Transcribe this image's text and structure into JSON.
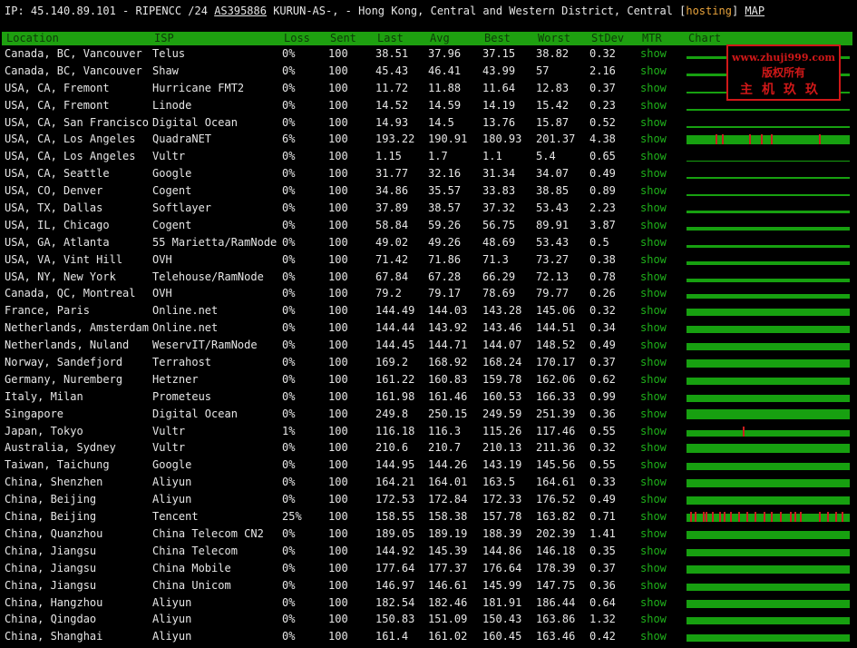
{
  "top": {
    "prefix": "IP: 45.140.89.101 - RIPENCC /24 ",
    "asn": "AS395886",
    "middle": " KURUN-AS-, - Hong Kong, Central and Western District, Central [",
    "tag": "hosting",
    "suffix": "] ",
    "map": "MAP"
  },
  "headers": {
    "location": "Location",
    "isp": "ISP",
    "loss": "Loss",
    "sent": "Sent",
    "last": "Last",
    "avg": "Avg",
    "best": "Best",
    "worst": "Worst",
    "stdev": "StDev",
    "mtr": "MTR",
    "chart": "Chart"
  },
  "watermark": {
    "line1": "www.zhuji999.com",
    "line2": "版权所有",
    "line3": "主机玖玖"
  },
  "colors": {
    "header_bg": "#1ea010",
    "link": "#1fb11a",
    "loss_spike": "#cc1f1f",
    "accent": "#e8a33c"
  },
  "rows": [
    {
      "location": "Canada, BC, Vancouver",
      "isp": "Telus",
      "loss": "0%",
      "sent": "100",
      "last": "38.51",
      "avg": "37.96",
      "best": "37.15",
      "worst": "38.82",
      "stdev": "0.32",
      "mtr": "show",
      "chart_level": 0.3,
      "spikes": []
    },
    {
      "location": "Canada, BC, Vancouver",
      "isp": "Shaw",
      "loss": "0%",
      "sent": "100",
      "last": "45.43",
      "avg": "46.41",
      "best": "43.99",
      "worst": "57",
      "stdev": "2.16",
      "mtr": "show",
      "chart_level": 0.3,
      "spikes": []
    },
    {
      "location": "USA, CA, Fremont",
      "isp": "Hurricane FMT2",
      "loss": "0%",
      "sent": "100",
      "last": "11.72",
      "avg": "11.88",
      "best": "11.64",
      "worst": "12.83",
      "stdev": "0.37",
      "mtr": "show",
      "chart_level": 0.2,
      "spikes": []
    },
    {
      "location": "USA, CA, Fremont",
      "isp": "Linode",
      "loss": "0%",
      "sent": "100",
      "last": "14.52",
      "avg": "14.59",
      "best": "14.19",
      "worst": "15.42",
      "stdev": "0.23",
      "mtr": "show",
      "chart_level": 0.2,
      "spikes": []
    },
    {
      "location": "USA, CA, San Francisco",
      "isp": "Digital Ocean",
      "loss": "0%",
      "sent": "100",
      "last": "14.93",
      "avg": "14.5",
      "best": "13.76",
      "worst": "15.87",
      "stdev": "0.52",
      "mtr": "show",
      "chart_level": 0.2,
      "spikes": []
    },
    {
      "location": "USA, CA, Los Angeles",
      "isp": "QuadraNET",
      "loss": "6%",
      "sent": "100",
      "last": "193.22",
      "avg": "190.91",
      "best": "180.93",
      "worst": "201.37",
      "stdev": "4.38",
      "mtr": "show",
      "chart_level": 0.9,
      "spikes": [
        0.18,
        0.22,
        0.39,
        0.46,
        0.52,
        0.82
      ]
    },
    {
      "location": "USA, CA, Los Angeles",
      "isp": "Vultr",
      "loss": "0%",
      "sent": "100",
      "last": "1.15",
      "avg": "1.7",
      "best": "1.1",
      "worst": "5.4",
      "stdev": "0.65",
      "mtr": "show",
      "chart_level": 0.1,
      "spikes": []
    },
    {
      "location": "USA, CA, Seattle",
      "isp": "Google",
      "loss": "0%",
      "sent": "100",
      "last": "31.77",
      "avg": "32.16",
      "best": "31.34",
      "worst": "34.07",
      "stdev": "0.49",
      "mtr": "show",
      "chart_level": 0.2,
      "spikes": []
    },
    {
      "location": "USA, CO, Denver",
      "isp": "Cogent",
      "loss": "0%",
      "sent": "100",
      "last": "34.86",
      "avg": "35.57",
      "best": "33.83",
      "worst": "38.85",
      "stdev": "0.89",
      "mtr": "show",
      "chart_level": 0.2,
      "spikes": []
    },
    {
      "location": "USA, TX, Dallas",
      "isp": "Softlayer",
      "loss": "0%",
      "sent": "100",
      "last": "37.89",
      "avg": "38.57",
      "best": "37.32",
      "worst": "53.43",
      "stdev": "2.23",
      "mtr": "show",
      "chart_level": 0.25,
      "spikes": []
    },
    {
      "location": "USA, IL, Chicago",
      "isp": "Cogent",
      "loss": "0%",
      "sent": "100",
      "last": "58.84",
      "avg": "59.26",
      "best": "56.75",
      "worst": "89.91",
      "stdev": "3.87",
      "mtr": "show",
      "chart_level": 0.35,
      "spikes": []
    },
    {
      "location": "USA, GA, Atlanta",
      "isp": "55 Marietta/RamNode",
      "loss": "0%",
      "sent": "100",
      "last": "49.02",
      "avg": "49.26",
      "best": "48.69",
      "worst": "53.43",
      "stdev": "0.5",
      "mtr": "show",
      "chart_level": 0.3,
      "spikes": []
    },
    {
      "location": "USA, VA, Vint Hill",
      "isp": "OVH",
      "loss": "0%",
      "sent": "100",
      "last": "71.42",
      "avg": "71.86",
      "best": "71.3",
      "worst": "73.27",
      "stdev": "0.38",
      "mtr": "show",
      "chart_level": 0.4,
      "spikes": []
    },
    {
      "location": "USA, NY, New York",
      "isp": "Telehouse/RamNode",
      "loss": "0%",
      "sent": "100",
      "last": "67.84",
      "avg": "67.28",
      "best": "66.29",
      "worst": "72.13",
      "stdev": "0.78",
      "mtr": "show",
      "chart_level": 0.4,
      "spikes": []
    },
    {
      "location": "Canada, QC, Montreal",
      "isp": "OVH",
      "loss": "0%",
      "sent": "100",
      "last": "79.2",
      "avg": "79.17",
      "best": "78.69",
      "worst": "79.77",
      "stdev": "0.26",
      "mtr": "show",
      "chart_level": 0.45,
      "spikes": []
    },
    {
      "location": "France, Paris",
      "isp": "Online.net",
      "loss": "0%",
      "sent": "100",
      "last": "144.49",
      "avg": "144.03",
      "best": "143.28",
      "worst": "145.06",
      "stdev": "0.32",
      "mtr": "show",
      "chart_level": 0.7,
      "spikes": []
    },
    {
      "location": "Netherlands, Amsterdam",
      "isp": "Online.net",
      "loss": "0%",
      "sent": "100",
      "last": "144.44",
      "avg": "143.92",
      "best": "143.46",
      "worst": "144.51",
      "stdev": "0.34",
      "mtr": "show",
      "chart_level": 0.7,
      "spikes": []
    },
    {
      "location": "Netherlands, Nuland",
      "isp": "WeservIT/RamNode",
      "loss": "0%",
      "sent": "100",
      "last": "144.45",
      "avg": "144.71",
      "best": "144.07",
      "worst": "148.52",
      "stdev": "0.49",
      "mtr": "show",
      "chart_level": 0.7,
      "spikes": []
    },
    {
      "location": "Norway, Sandefjord",
      "isp": "Terrahost",
      "loss": "0%",
      "sent": "100",
      "last": "169.2",
      "avg": "168.92",
      "best": "168.24",
      "worst": "170.17",
      "stdev": "0.37",
      "mtr": "show",
      "chart_level": 0.8,
      "spikes": []
    },
    {
      "location": "Germany, Nuremberg",
      "isp": "Hetzner",
      "loss": "0%",
      "sent": "100",
      "last": "161.22",
      "avg": "160.83",
      "best": "159.78",
      "worst": "162.06",
      "stdev": "0.62",
      "mtr": "show",
      "chart_level": 0.75,
      "spikes": []
    },
    {
      "location": "Italy, Milan",
      "isp": "Prometeus",
      "loss": "0%",
      "sent": "100",
      "last": "161.98",
      "avg": "161.46",
      "best": "160.53",
      "worst": "166.33",
      "stdev": "0.99",
      "mtr": "show",
      "chart_level": 0.75,
      "spikes": []
    },
    {
      "location": "Singapore",
      "isp": "Digital Ocean",
      "loss": "0%",
      "sent": "100",
      "last": "249.8",
      "avg": "250.15",
      "best": "249.59",
      "worst": "251.39",
      "stdev": "0.36",
      "mtr": "show",
      "chart_level": 1.0,
      "spikes": []
    },
    {
      "location": "Japan, Tokyo",
      "isp": "Vultr",
      "loss": "1%",
      "sent": "100",
      "last": "116.18",
      "avg": "116.3",
      "best": "115.26",
      "worst": "117.46",
      "stdev": "0.55",
      "mtr": "show",
      "chart_level": 0.6,
      "spikes": [
        0.35
      ]
    },
    {
      "location": "Australia, Sydney",
      "isp": "Vultr",
      "loss": "0%",
      "sent": "100",
      "last": "210.6",
      "avg": "210.7",
      "best": "210.13",
      "worst": "211.36",
      "stdev": "0.32",
      "mtr": "show",
      "chart_level": 0.9,
      "spikes": []
    },
    {
      "location": "Taiwan, Taichung",
      "isp": "Google",
      "loss": "0%",
      "sent": "100",
      "last": "144.95",
      "avg": "144.26",
      "best": "143.19",
      "worst": "145.56",
      "stdev": "0.55",
      "mtr": "show",
      "chart_level": 0.7,
      "spikes": []
    },
    {
      "location": "China, Shenzhen",
      "isp": "Aliyun",
      "loss": "0%",
      "sent": "100",
      "last": "164.21",
      "avg": "164.01",
      "best": "163.5",
      "worst": "164.61",
      "stdev": "0.33",
      "mtr": "show",
      "chart_level": 0.78,
      "spikes": []
    },
    {
      "location": "China, Beijing",
      "isp": "Aliyun",
      "loss": "0%",
      "sent": "100",
      "last": "172.53",
      "avg": "172.84",
      "best": "172.33",
      "worst": "176.52",
      "stdev": "0.49",
      "mtr": "show",
      "chart_level": 0.8,
      "spikes": []
    },
    {
      "location": "China, Beijing",
      "isp": "Tencent",
      "loss": "25%",
      "sent": "100",
      "last": "158.55",
      "avg": "158.38",
      "best": "157.78",
      "worst": "163.82",
      "stdev": "0.71",
      "mtr": "show",
      "chart_level": 0.78,
      "spikes": [
        0.02,
        0.05,
        0.1,
        0.12,
        0.16,
        0.2,
        0.23,
        0.27,
        0.32,
        0.37,
        0.42,
        0.48,
        0.52,
        0.58,
        0.64,
        0.67,
        0.7,
        0.82,
        0.87,
        0.92,
        0.96
      ]
    },
    {
      "location": "China, Quanzhou",
      "isp": "China Telecom CN2",
      "loss": "0%",
      "sent": "100",
      "last": "189.05",
      "avg": "189.19",
      "best": "188.39",
      "worst": "202.39",
      "stdev": "1.41",
      "mtr": "show",
      "chart_level": 0.85,
      "spikes": []
    },
    {
      "location": "China, Jiangsu",
      "isp": "China Telecom",
      "loss": "0%",
      "sent": "100",
      "last": "144.92",
      "avg": "145.39",
      "best": "144.86",
      "worst": "146.18",
      "stdev": "0.35",
      "mtr": "show",
      "chart_level": 0.7,
      "spikes": []
    },
    {
      "location": "China, Jiangsu",
      "isp": "China Mobile",
      "loss": "0%",
      "sent": "100",
      "last": "177.64",
      "avg": "177.37",
      "best": "176.64",
      "worst": "178.39",
      "stdev": "0.37",
      "mtr": "show",
      "chart_level": 0.82,
      "spikes": []
    },
    {
      "location": "China, Jiangsu",
      "isp": "China Unicom",
      "loss": "0%",
      "sent": "100",
      "last": "146.97",
      "avg": "146.61",
      "best": "145.99",
      "worst": "147.75",
      "stdev": "0.36",
      "mtr": "show",
      "chart_level": 0.7,
      "spikes": []
    },
    {
      "location": "China, Hangzhou",
      "isp": "Aliyun",
      "loss": "0%",
      "sent": "100",
      "last": "182.54",
      "avg": "182.46",
      "best": "181.91",
      "worst": "186.44",
      "stdev": "0.64",
      "mtr": "show",
      "chart_level": 0.84,
      "spikes": []
    },
    {
      "location": "China, Qingdao",
      "isp": "Aliyun",
      "loss": "0%",
      "sent": "100",
      "last": "150.83",
      "avg": "151.09",
      "best": "150.43",
      "worst": "163.86",
      "stdev": "1.32",
      "mtr": "show",
      "chart_level": 0.72,
      "spikes": []
    },
    {
      "location": "China, Shanghai",
      "isp": "Aliyun",
      "loss": "0%",
      "sent": "100",
      "last": "161.4",
      "avg": "161.02",
      "best": "160.45",
      "worst": "163.46",
      "stdev": "0.42",
      "mtr": "show",
      "chart_level": 0.76,
      "spikes": []
    }
  ]
}
